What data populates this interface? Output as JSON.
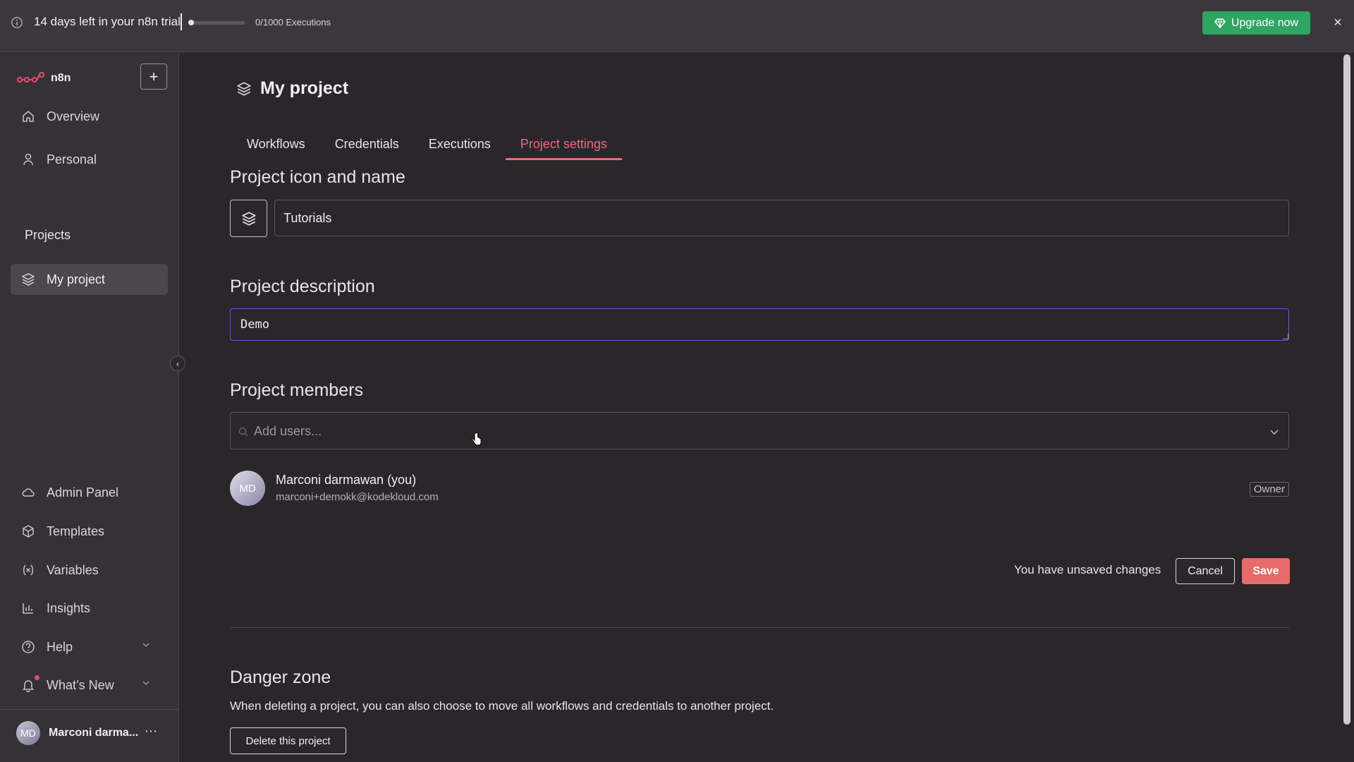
{
  "banner": {
    "trial_text": "14 days left in your n8n trial",
    "executions_text": "0/1000 Executions",
    "executions_used_fraction": 0,
    "upgrade_label": "Upgrade now",
    "upgrade_color": "#2ea561"
  },
  "sidebar": {
    "logo_text": "n8n",
    "nav": [
      {
        "label": "Overview",
        "icon": "home-icon"
      },
      {
        "label": "Personal",
        "icon": "user-icon"
      }
    ],
    "projects_heading": "Projects",
    "projects": [
      {
        "label": "My project",
        "icon": "layers-icon",
        "active": true
      }
    ],
    "bottom": [
      {
        "label": "Admin Panel",
        "icon": "cloud-icon"
      },
      {
        "label": "Templates",
        "icon": "templates-icon"
      },
      {
        "label": "Variables",
        "icon": "variables-icon"
      },
      {
        "label": "Insights",
        "icon": "insights-icon"
      },
      {
        "label": "Help",
        "icon": "help-icon"
      },
      {
        "label": "What’s New",
        "icon": "bell-icon"
      }
    ],
    "user": {
      "initials": "MD",
      "name": "Marconi darma..."
    }
  },
  "main": {
    "title": "My project",
    "tabs": [
      {
        "label": "Workflows"
      },
      {
        "label": "Credentials"
      },
      {
        "label": "Executions"
      },
      {
        "label": "Project settings",
        "active": true
      }
    ],
    "icon_name_heading": "Project icon and name",
    "project_name_value": "Tutorials",
    "description_heading": "Project description",
    "description_value": "Demo",
    "members_heading": "Project members",
    "add_users_placeholder": "Add users...",
    "member": {
      "initials": "MD",
      "name": "Marconi darmawan (you)",
      "email": "marconi+demokk@kodekloud.com",
      "role": "Owner"
    },
    "unsaved_text": "You have unsaved changes",
    "cancel_label": "Cancel",
    "save_label": "Save",
    "danger_heading": "Danger zone",
    "danger_text": "When deleting a project, you can also choose to move all workflows and credentials to another project.",
    "delete_label": "Delete this project"
  },
  "colors": {
    "accent": "#ea6a85",
    "save": "#e86b6b",
    "focus_border": "#6b5ad3"
  }
}
